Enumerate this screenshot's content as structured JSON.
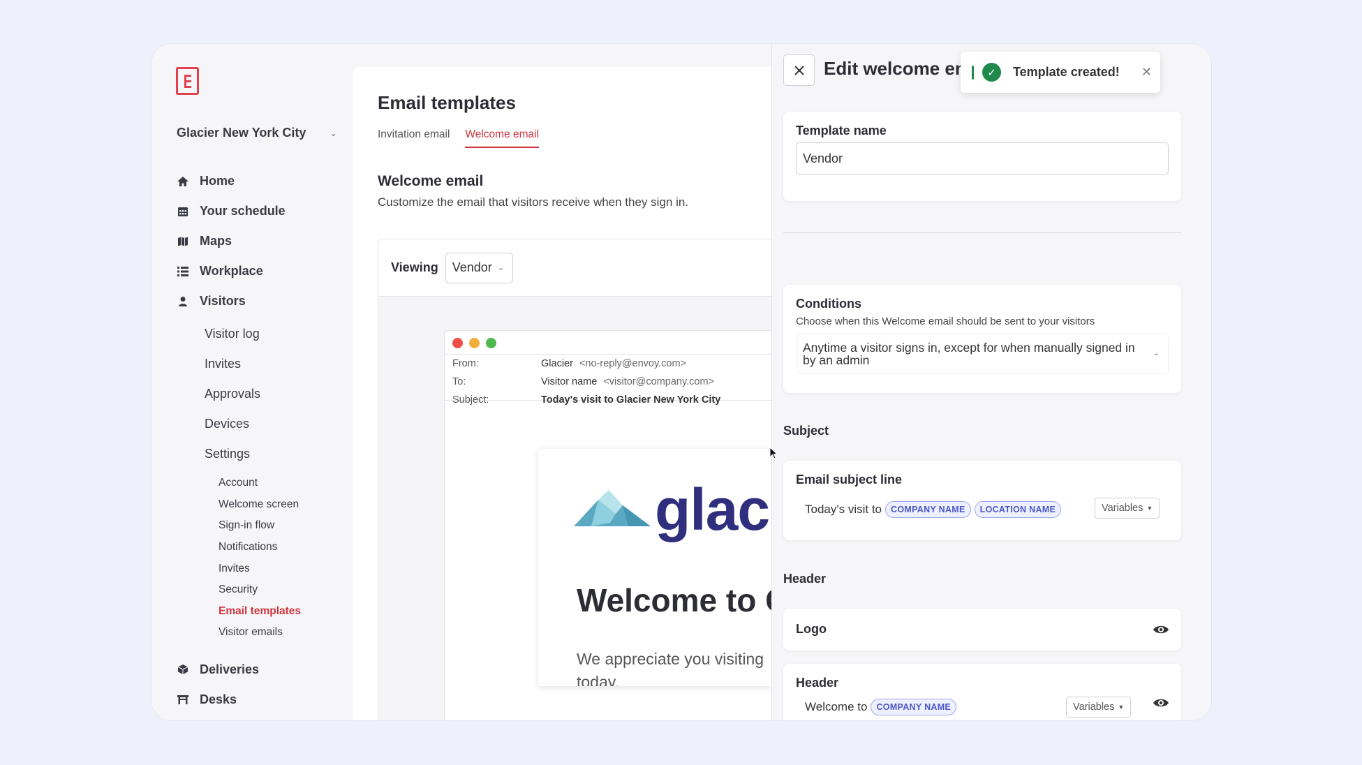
{
  "colors": {
    "accent": "#d0343e",
    "success": "#1f8a4b",
    "pill": "#4a55c9"
  },
  "sidebar": {
    "logo_icon": "envoy-logo-icon",
    "org": {
      "name": "Glacier New York City",
      "chevron_icon": "chevron-down-icon"
    },
    "nav": [
      {
        "label": "Home",
        "icon": "home-icon"
      },
      {
        "label": "Your schedule",
        "icon": "calendar-icon"
      },
      {
        "label": "Maps",
        "icon": "map-icon"
      },
      {
        "label": "Workplace",
        "icon": "list-icon"
      },
      {
        "label": "Visitors",
        "icon": "person-icon"
      }
    ],
    "visitors_sub": [
      "Visitor log",
      "Invites",
      "Approvals",
      "Devices",
      "Settings"
    ],
    "settings_sub": [
      "Account",
      "Welcome screen",
      "Sign-in flow",
      "Notifications",
      "Invites",
      "Security",
      "Email templates",
      "Visitor emails"
    ],
    "bottom_nav": [
      {
        "label": "Deliveries",
        "icon": "box-icon"
      },
      {
        "label": "Desks",
        "icon": "desk-icon"
      }
    ]
  },
  "main": {
    "title": "Email templates",
    "tabs": [
      "Invitation email",
      "Welcome email"
    ],
    "section_title": "Welcome email",
    "section_desc": "Customize the email that visitors receive when they sign in.",
    "viewing_label": "Viewing",
    "viewing_value": "Vendor",
    "preview": {
      "from_label": "From:",
      "from_name": "Glacier",
      "from_email": "<no-reply@envoy.com>",
      "to_label": "To:",
      "to_name": "Visitor name",
      "to_email": "<visitor@company.com>",
      "subject_label": "Subject:",
      "subject_value": "Today's visit to Glacier New York City",
      "brand_text": "glac",
      "heading": "Welcome to G",
      "body": "We appreciate you visiting today."
    }
  },
  "panel": {
    "title": "Edit welcome email",
    "toast": "Template created!",
    "template_name_label": "Template name",
    "template_name_value": "Vendor",
    "conditions_title": "Conditions",
    "conditions_desc": "Choose when this Welcome email should be sent to your visitors",
    "conditions_value": "Anytime a visitor signs in, except for when manually signed in by an admin",
    "subject_section": "Subject",
    "subject_line_label": "Email subject line",
    "subject_prefix": "Today's visit to",
    "subject_pills": [
      "COMPANY NAME",
      "LOCATION NAME"
    ],
    "variables_label": "Variables",
    "header_section": "Header",
    "logo_label": "Logo",
    "header_label": "Header",
    "header_prefix": "Welcome to",
    "header_pill": "COMPANY NAME"
  }
}
